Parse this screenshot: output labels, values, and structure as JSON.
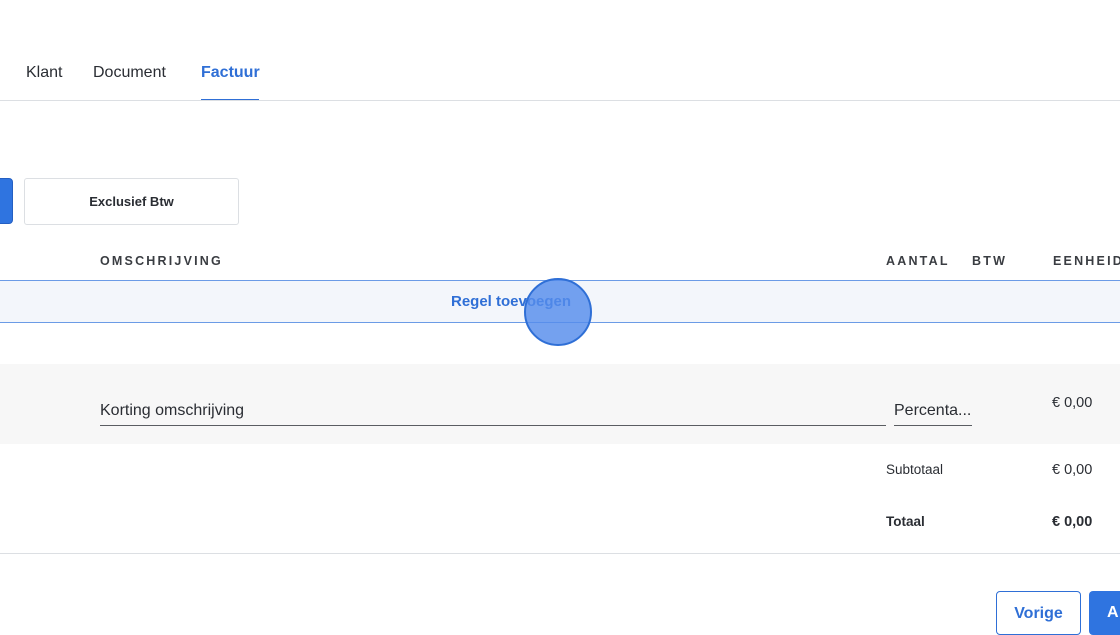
{
  "tabs": {
    "items": [
      {
        "label": "Klant"
      },
      {
        "label": "Document"
      },
      {
        "label": "Factuur"
      }
    ],
    "active": "Factuur"
  },
  "vat_toggle": {
    "exclusive_label": "Exclusief Btw"
  },
  "table": {
    "headers": {
      "description": "OMSCHRIJVING",
      "quantity": "AANTAL",
      "vat": "BTW",
      "unit": "EENHEID"
    },
    "add_row_label": "Regel toevoegen"
  },
  "discount": {
    "description_placeholder": "Korting omschrijving",
    "type_value": "Percenta...",
    "amount": "€ 0,00"
  },
  "totals": {
    "subtotal_label": "Subtotaal",
    "subtotal_value": "€ 0,00",
    "total_label": "Totaal",
    "total_value": "€ 0,00"
  },
  "footer": {
    "previous_label": "Vorige",
    "next_label": "A"
  },
  "colors": {
    "accent": "#2f6fd6",
    "primary_button": "#2f74e0",
    "add_row_bg": "#f3f6fb",
    "discount_row_bg": "#f7f7f7"
  }
}
